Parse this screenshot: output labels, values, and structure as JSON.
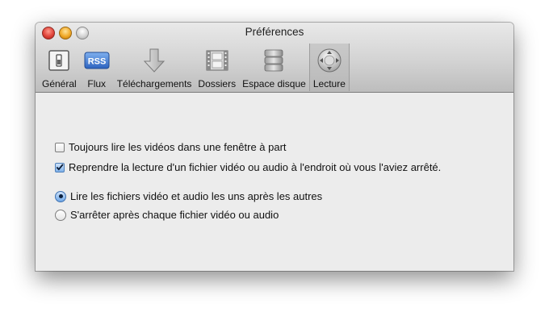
{
  "window": {
    "title": "Préférences"
  },
  "toolbar": {
    "items": [
      {
        "label": "Général",
        "icon": "switch-icon",
        "selected": false
      },
      {
        "label": "Flux",
        "icon": "rss-icon",
        "selected": false
      },
      {
        "label": "Téléchargements",
        "icon": "download-arrow-icon",
        "selected": false
      },
      {
        "label": "Dossiers",
        "icon": "film-folder-icon",
        "selected": false
      },
      {
        "label": "Espace disque",
        "icon": "disk-stack-icon",
        "selected": false
      },
      {
        "label": "Lecture",
        "icon": "playback-control-icon",
        "selected": true
      }
    ],
    "rss_text": "RSS"
  },
  "options": {
    "checkboxes": [
      {
        "label": "Toujours lire les vidéos dans une fenêtre à part",
        "checked": false
      },
      {
        "label": "Reprendre la lecture d'un fichier vidéo ou audio à l'endroit où vous l'aviez arrêté.",
        "checked": true
      }
    ],
    "radios": [
      {
        "label": "Lire les fichiers vidéo et audio les uns après les autres",
        "selected": true
      },
      {
        "label": "S'arrêter après chaque fichier vidéo ou audio",
        "selected": false
      }
    ]
  },
  "colors": {
    "accent": "#4e7fb8",
    "window_bg": "#ececec"
  }
}
